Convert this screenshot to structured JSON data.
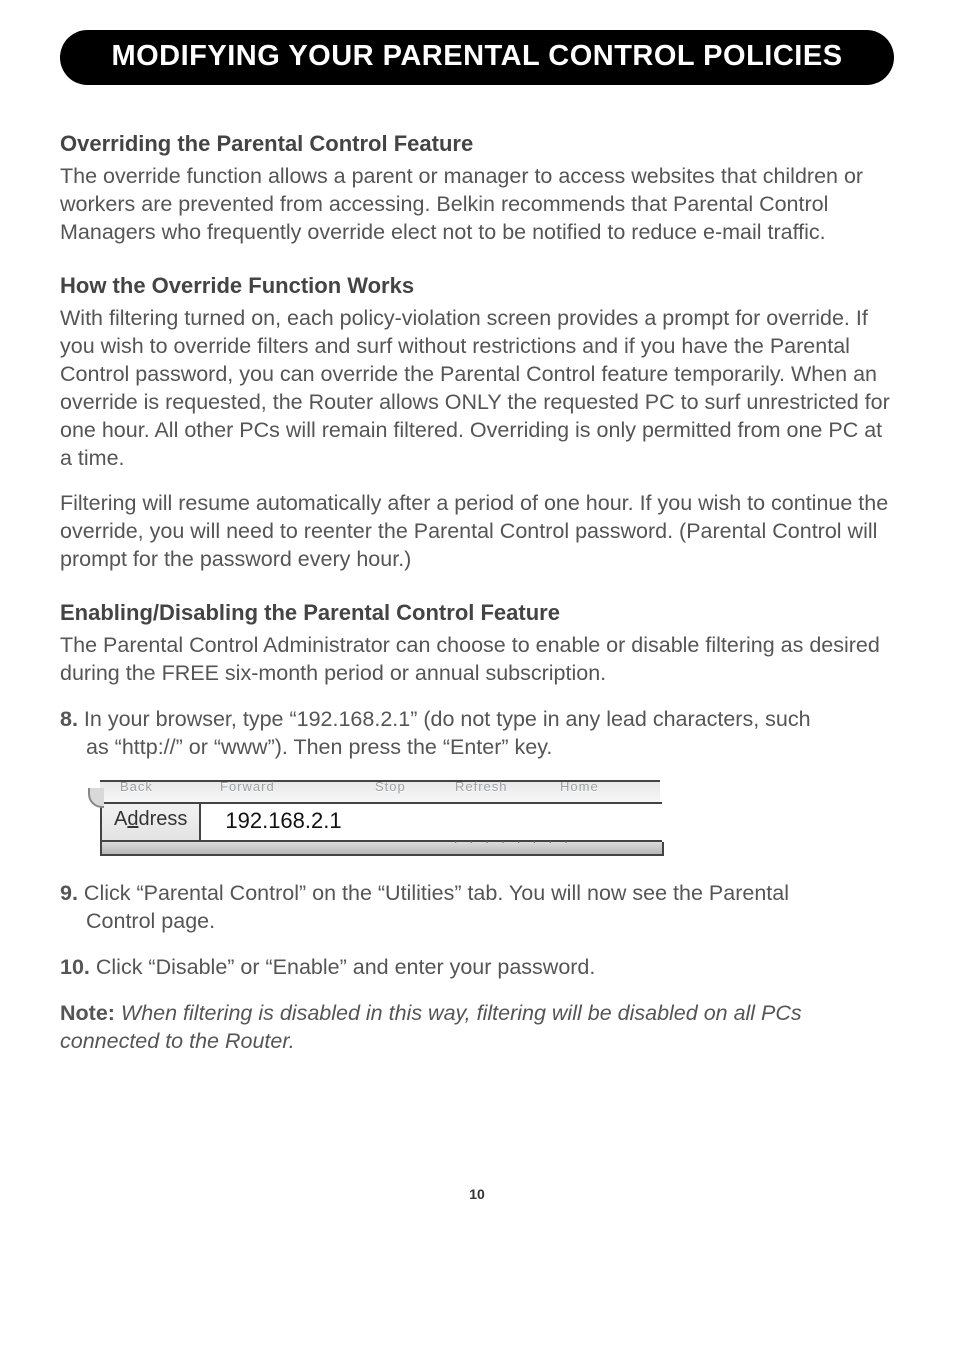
{
  "title": "MODIFYING YOUR PARENTAL CONTROL POLICIES",
  "sec1_heading": "Overriding the Parental Control Feature",
  "sec1_body": "The override function allows a parent or manager to access websites that children or workers are prevented from accessing. Belkin recommends that Parental Control Managers who frequently override elect not to be notified to reduce e-mail traffic.",
  "sec2_heading": "How the Override Function Works",
  "sec2_body1": "With filtering turned on, each policy-violation screen provides a prompt for override. If you wish to override filters and surf without restrictions and if you have the Parental Control password, you can override the Parental Control feature temporarily. When an override is requested, the Router allows ONLY the requested PC to surf unrestricted for one hour. All other PCs will remain filtered. Overriding is only permitted from one PC at a time.",
  "sec2_body2": "Filtering will resume automatically after a period of one hour. If you wish to continue the override, you will need to reenter the Parental Control password. (Parental Control will prompt for the password every hour.)",
  "sec3_heading": "Enabling/Disabling the Parental Control Feature",
  "sec3_body": "The Parental Control Administrator can choose to enable or disable filtering as desired during the FREE six-month period or annual subscription.",
  "step8_num": "8.",
  "step8_line1": "In your browser, type “192.168.2.1” (do not type in any lead characters, such",
  "step8_line2": "as “http://” or “www”). Then press the “Enter” key.",
  "figure": {
    "address_label_html": "A<span>d</span>dress",
    "address_value": "192.168.2.1",
    "ghost_back": "Back",
    "ghost_forward": "Forward",
    "ghost_stop": "Stop",
    "ghost_refresh": "Refresh",
    "ghost_home": "Home"
  },
  "step9_num": "9.",
  "step9_line1": "Click “Parental Control” on the “Utilities” tab. You will now see the Parental",
  "step9_line2": "Control page.",
  "step10_num": "10.",
  "step10_text": "Click “Disable” or “Enable” and enter your password.",
  "note_label": "Note:",
  "note_body": "When filtering is disabled in this way, filtering will be disabled on all PCs connected to the Router.",
  "page_number": "10"
}
